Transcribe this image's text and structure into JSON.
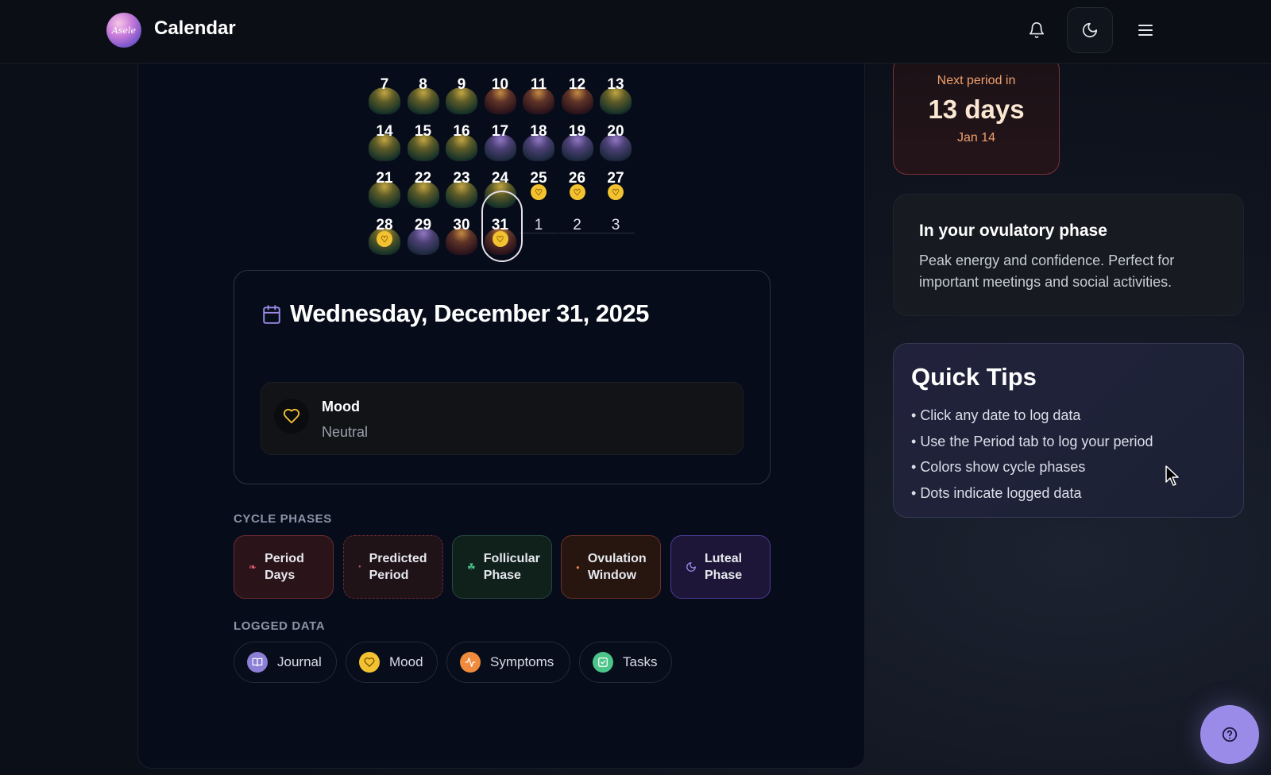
{
  "header": {
    "logo_text": "Asele",
    "title": "Calendar"
  },
  "calendar": {
    "days": [
      {
        "n": "7",
        "row": 0,
        "col": 0
      },
      {
        "n": "8",
        "row": 0,
        "col": 1
      },
      {
        "n": "9",
        "row": 0,
        "col": 2
      },
      {
        "n": "10",
        "row": 0,
        "col": 3
      },
      {
        "n": "11",
        "row": 0,
        "col": 4
      },
      {
        "n": "12",
        "row": 0,
        "col": 5
      },
      {
        "n": "13",
        "row": 0,
        "col": 6
      },
      {
        "n": "14",
        "row": 1,
        "col": 0
      },
      {
        "n": "15",
        "row": 1,
        "col": 1
      },
      {
        "n": "16",
        "row": 1,
        "col": 2
      },
      {
        "n": "17",
        "row": 1,
        "col": 3
      },
      {
        "n": "18",
        "row": 1,
        "col": 4
      },
      {
        "n": "19",
        "row": 1,
        "col": 5
      },
      {
        "n": "20",
        "row": 1,
        "col": 6
      },
      {
        "n": "21",
        "row": 2,
        "col": 0
      },
      {
        "n": "22",
        "row": 2,
        "col": 1
      },
      {
        "n": "23",
        "row": 2,
        "col": 2
      },
      {
        "n": "24",
        "row": 2,
        "col": 3
      },
      {
        "n": "25",
        "row": 2,
        "col": 4
      },
      {
        "n": "26",
        "row": 2,
        "col": 5
      },
      {
        "n": "27",
        "row": 2,
        "col": 6
      },
      {
        "n": "28",
        "row": 3,
        "col": 0
      },
      {
        "n": "29",
        "row": 3,
        "col": 1
      },
      {
        "n": "30",
        "row": 3,
        "col": 2
      },
      {
        "n": "31",
        "row": 3,
        "col": 3
      },
      {
        "n": "1",
        "row": 3,
        "col": 4
      },
      {
        "n": "2",
        "row": 3,
        "col": 5
      },
      {
        "n": "3",
        "row": 3,
        "col": 6
      }
    ]
  },
  "selected_day": {
    "title": "Wednesday, December 31, 2025",
    "mood_label": "Mood",
    "mood_value": "Neutral"
  },
  "cycle_phases": {
    "label": "CYCLE PHASES",
    "items": [
      {
        "line1": "Period",
        "line2": "Days"
      },
      {
        "line1": "Predicted",
        "line2": "Period"
      },
      {
        "line1": "Follicular",
        "line2": "Phase"
      },
      {
        "line1": "Ovulation",
        "line2": "Window"
      },
      {
        "line1": "Luteal",
        "line2": "Phase"
      }
    ]
  },
  "logged_data": {
    "label": "LOGGED DATA",
    "items": [
      "Journal",
      "Mood",
      "Symptoms",
      "Tasks"
    ]
  },
  "next_period": {
    "label": "Next period in",
    "days": "13 days",
    "date": "Jan 14"
  },
  "phase_info": {
    "title": "In your ovulatory phase",
    "description": "Peak energy and confidence. Perfect for important meetings and social activities."
  },
  "quick_tips": {
    "title": "Quick Tips",
    "items": [
      "Click any date to log data",
      "Use the Period tab to log your period",
      "Colors show cycle phases",
      "Dots indicate logged data"
    ]
  },
  "colors": {
    "accent": "#9b8be8",
    "period": "#e25c6a",
    "mood": "#f2c230",
    "symptoms": "#f08a3c",
    "tasks": "#4cc48a",
    "journal": "#8b7fd6"
  }
}
